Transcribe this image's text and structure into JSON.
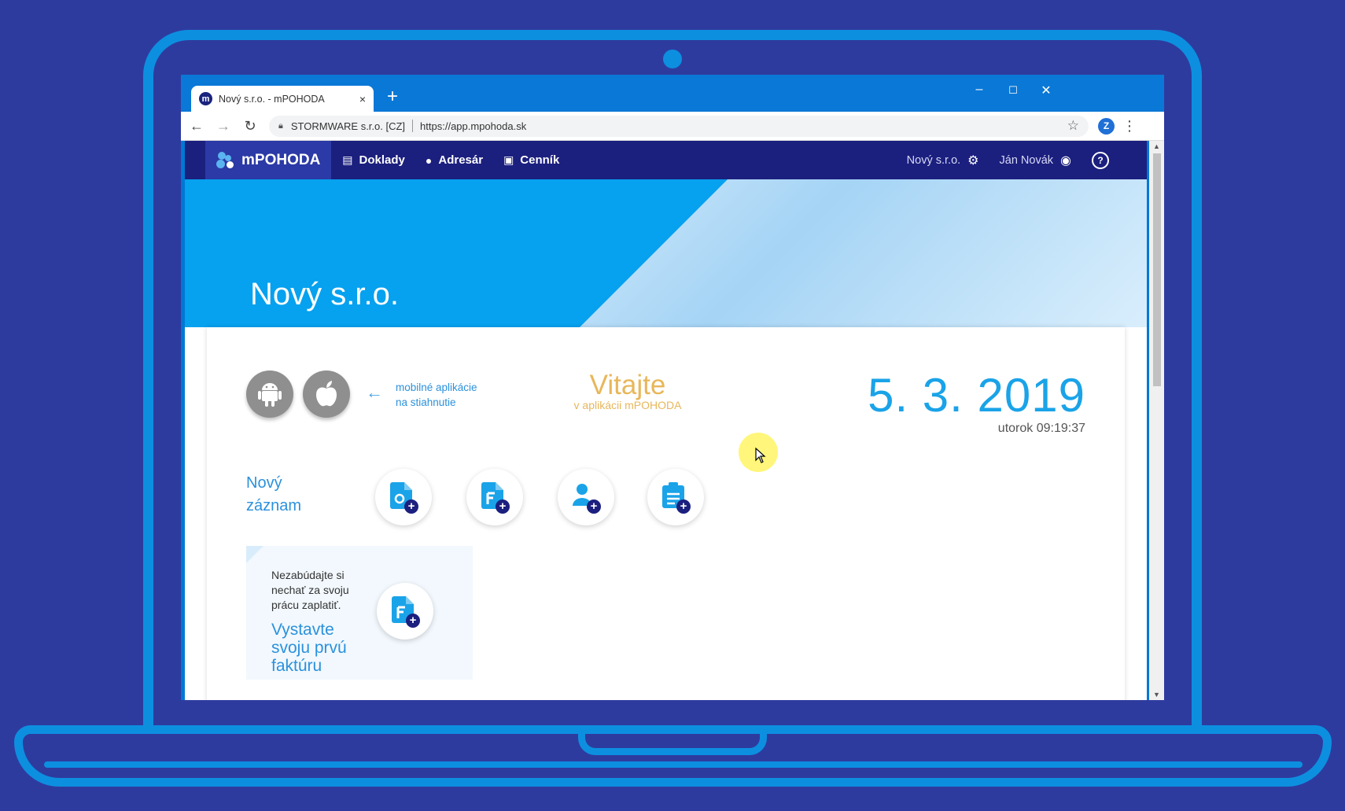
{
  "browser": {
    "tab_title": "Nový s.r.o. - mPOHODA",
    "tab_close": "×",
    "new_tab": "+",
    "site_identity": "STORMWARE s.r.o. [CZ]",
    "url": "https://app.mpohoda.sk",
    "window_controls": [
      "–",
      "☐",
      "✕"
    ]
  },
  "app": {
    "brand": "mPOHODA",
    "nav": [
      {
        "label": "Doklady",
        "icon": "documents-icon"
      },
      {
        "label": "Adresár",
        "icon": "person-icon"
      },
      {
        "label": "Cenník",
        "icon": "clipboard-icon"
      }
    ],
    "company": "Nový s.r.o.",
    "user": "Ján Novák",
    "hero_title": "Nový s.r.o."
  },
  "dashboard": {
    "mobile_line1": "mobilné aplikácie",
    "mobile_line2": "na stiahnutie",
    "welcome_title": "Vitajte",
    "welcome_sub": "v aplikácii mPOHODA",
    "date": "5. 3. 2019",
    "time": "utorok 09:19:37",
    "new_record_line1": "Nový",
    "new_record_line2": "záznam",
    "promo_text_1": "Nezabúdajte si",
    "promo_text_2": "nechať za svoju",
    "promo_text_3": "prácu zaplatiť.",
    "promo_cta_1": "Vystavte",
    "promo_cta_2": "svoju prvú",
    "promo_cta_3": "faktúru"
  },
  "colors": {
    "accent": "#06a1ef",
    "nav_bg": "#1b1f7e",
    "welcome": "#e8b75a",
    "frame": "#0d8fe0"
  }
}
